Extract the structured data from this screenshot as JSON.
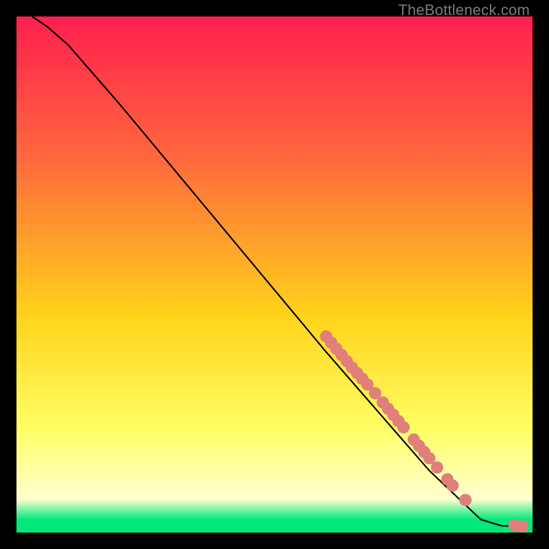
{
  "watermark": "TheBottleneck.com",
  "colors": {
    "grad_top": "#ff1f4f",
    "grad_upper": "#ff6a3c",
    "grad_mid": "#ffd31a",
    "grad_low": "#ffff66",
    "grad_pale": "#ffffd0",
    "grad_green": "#00e97a",
    "line": "#000000",
    "dot": "#e0807a",
    "bg": "#000000"
  },
  "chart_data": {
    "type": "line",
    "title": "",
    "xlabel": "",
    "ylabel": "",
    "xlim": [
      0,
      100
    ],
    "ylim": [
      0,
      100
    ],
    "legend": false,
    "grid": false,
    "curve": [
      {
        "x": 3,
        "y": 100
      },
      {
        "x": 6,
        "y": 98
      },
      {
        "x": 10,
        "y": 94.5
      },
      {
        "x": 20,
        "y": 83
      },
      {
        "x": 30,
        "y": 71
      },
      {
        "x": 40,
        "y": 59
      },
      {
        "x": 50,
        "y": 47
      },
      {
        "x": 60,
        "y": 35
      },
      {
        "x": 70,
        "y": 23.5
      },
      {
        "x": 80,
        "y": 12
      },
      {
        "x": 90,
        "y": 2.5
      },
      {
        "x": 94,
        "y": 1.3
      },
      {
        "x": 98,
        "y": 1.2
      }
    ],
    "series": [
      {
        "name": "cluster",
        "points": [
          {
            "x": 60.0,
            "y": 38.0
          },
          {
            "x": 61.0,
            "y": 36.8
          },
          {
            "x": 62.0,
            "y": 35.6
          },
          {
            "x": 63.0,
            "y": 34.4
          },
          {
            "x": 64.0,
            "y": 33.2
          },
          {
            "x": 65.0,
            "y": 32.0
          },
          {
            "x": 66.0,
            "y": 30.9
          },
          {
            "x": 67.0,
            "y": 29.8
          },
          {
            "x": 68.0,
            "y": 28.7
          },
          {
            "x": 69.5,
            "y": 27.0
          },
          {
            "x": 71.0,
            "y": 25.2
          },
          {
            "x": 72.0,
            "y": 24.0
          },
          {
            "x": 73.0,
            "y": 22.8
          },
          {
            "x": 74.0,
            "y": 21.6
          },
          {
            "x": 75.0,
            "y": 20.4
          },
          {
            "x": 77.0,
            "y": 18.0
          },
          {
            "x": 78.0,
            "y": 16.8
          },
          {
            "x": 79.0,
            "y": 15.6
          },
          {
            "x": 80.0,
            "y": 14.4
          },
          {
            "x": 81.5,
            "y": 12.6
          },
          {
            "x": 83.5,
            "y": 10.3
          },
          {
            "x": 84.5,
            "y": 9.1
          },
          {
            "x": 87.0,
            "y": 6.3
          },
          {
            "x": 96.5,
            "y": 1.4
          },
          {
            "x": 98.0,
            "y": 1.2
          }
        ]
      }
    ]
  }
}
